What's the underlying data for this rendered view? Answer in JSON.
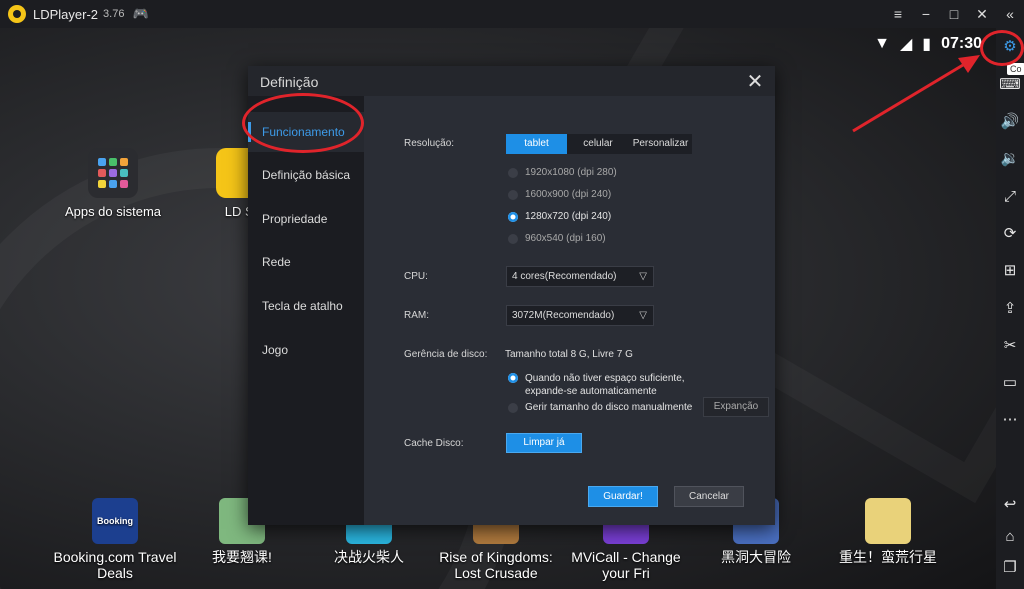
{
  "titlebar": {
    "title": "LDPlayer-2",
    "version": "3.76",
    "controls": [
      "≡",
      "−",
      "□",
      "✕",
      "«"
    ]
  },
  "status": {
    "clock": "07:30"
  },
  "desktop": {
    "top_icons": [
      {
        "label": "Apps do sistema"
      },
      {
        "label": "LD St"
      }
    ],
    "bottom_apps": [
      {
        "label": "Booking.com Travel\nDeals",
        "img_text": "Booking",
        "color": "#1c3f8f"
      },
      {
        "label": "我要翘课!",
        "img_text": "",
        "color": "#7fb87f"
      },
      {
        "label": "决战火柴人",
        "img_text": "",
        "color": "#2ab6e0"
      },
      {
        "label": "Rise of Kingdoms:\nLost Crusade",
        "img_text": "",
        "color": "#b07a3e"
      },
      {
        "label": "MViCall - Change\nyour Fri",
        "img_text": "",
        "color": "#7a3fd6"
      },
      {
        "label": "黑洞大冒险",
        "img_text": "",
        "color": "#4a6fc0"
      },
      {
        "label": "重生！蛮荒行星",
        "img_text": "",
        "color": "#e9d27a"
      }
    ]
  },
  "sidebar": {
    "tooltip": "Co",
    "items": [
      "⚙",
      "⌨",
      "🔊",
      "🔉",
      "⤢",
      "⟳",
      "⊞",
      "⇪",
      "✂",
      "▭",
      "⋯",
      "↩",
      "⌂",
      "❐"
    ]
  },
  "dialog": {
    "title": "Definição",
    "close": "✕",
    "nav": [
      {
        "label": "Funcionamento",
        "active": true
      },
      {
        "label": "Definição básica",
        "active": false
      },
      {
        "label": "Propriedade",
        "active": false
      },
      {
        "label": "Rede",
        "active": false
      },
      {
        "label": "Tecla de atalho",
        "active": false
      },
      {
        "label": "Jogo",
        "active": false
      }
    ],
    "resolution": {
      "label": "Resolução:",
      "modes": [
        "tablet",
        "celular",
        "Personalizar"
      ],
      "selected_mode": "tablet",
      "options": [
        "1920x1080  (dpi 280)",
        "1600x900  (dpi 240)",
        "1280x720  (dpi 240)",
        "960x540  (dpi 160)"
      ],
      "selected_option": 2
    },
    "cpu": {
      "label": "CPU:",
      "value": "4 cores(Recomendado)"
    },
    "ram": {
      "label": "RAM:",
      "value": "3072M(Recomendado)"
    },
    "disk": {
      "label": "Gerência de disco:",
      "summary": "Tamanho total 8 G,  Livre 7 G",
      "option_auto_1": "Quando não tiver espaço suficiente,",
      "option_auto_2": "expande-se automaticamente",
      "option_manual": "Gerir tamanho do disco manualmente",
      "expand_button": "Expanção"
    },
    "cache": {
      "label": "Cache Disco:",
      "button": "Limpar já"
    },
    "save_button": "Guardar!",
    "cancel_button": "Cancelar"
  },
  "colors": {
    "accent": "#1e8fe6",
    "annotation": "#e0242b",
    "logo": "#f5c518"
  }
}
